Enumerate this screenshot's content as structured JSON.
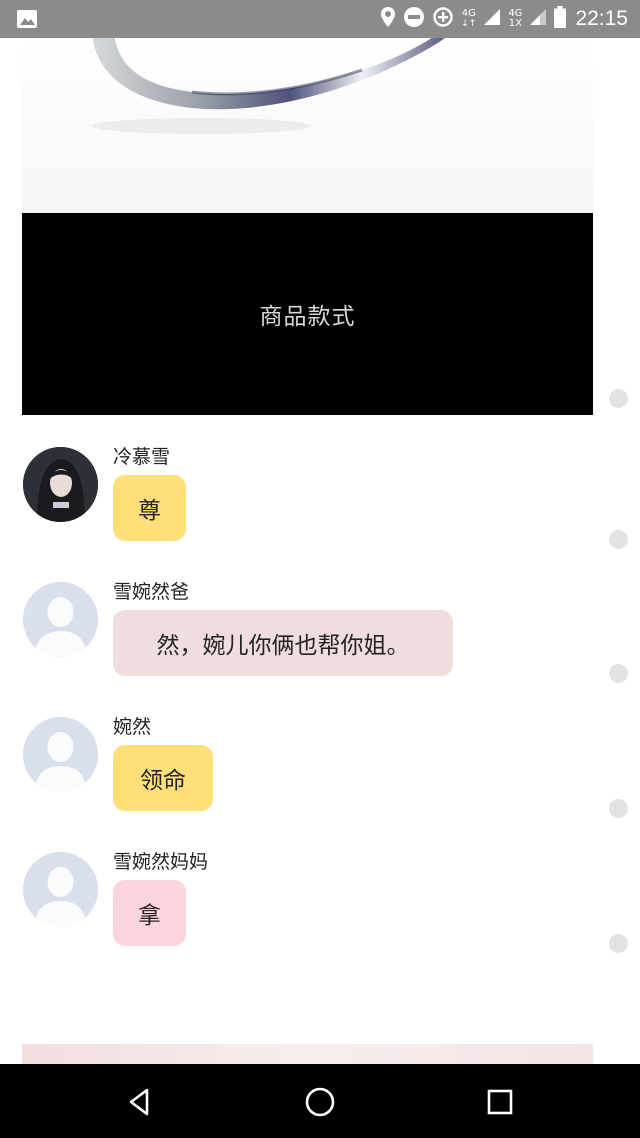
{
  "status_bar": {
    "time": "22:15",
    "network_1": "4G",
    "network_2_top": "4G",
    "network_2_bottom": "1X",
    "icons": [
      "image-icon",
      "location-icon",
      "do-not-disturb-icon",
      "data-saver-icon",
      "signal-icon",
      "signal-icon",
      "battery-icon"
    ]
  },
  "banner": {
    "text": "商品款式"
  },
  "messages": [
    {
      "sender": "冷慕雪",
      "text": "尊",
      "bubble_color": "#fedf7a",
      "avatar": "photo"
    },
    {
      "sender": "雪婉然爸",
      "text": "然，婉儿你俩也帮你姐。",
      "bubble_color": "#f0dedf",
      "avatar": "default-user-icon"
    },
    {
      "sender": "婉然",
      "text": "领命",
      "bubble_color": "#fedf7a",
      "avatar": "default-user-icon"
    },
    {
      "sender": "雪婉然妈妈",
      "text": "拿",
      "bubble_color": "#fdd4dd",
      "avatar": "default-user-icon"
    }
  ],
  "nav_bar": {
    "icons": [
      "back-icon",
      "home-icon",
      "recents-icon"
    ]
  }
}
